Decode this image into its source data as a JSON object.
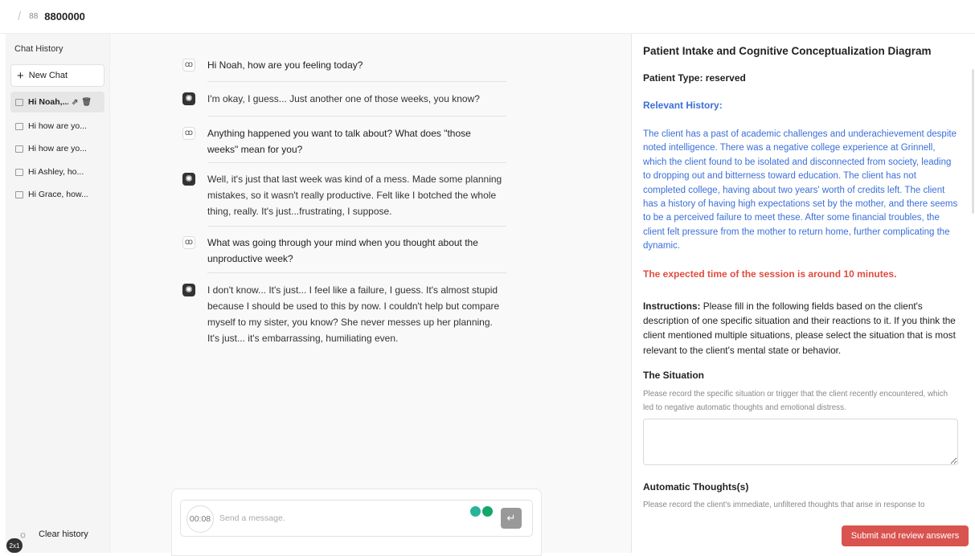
{
  "topbar": {
    "badge": "88",
    "title": "8800000"
  },
  "sidebar": {
    "heading": "Chat History",
    "new_chat": "New Chat",
    "items": [
      {
        "label": "Hi Noah,..."
      },
      {
        "label": "Hi how are yo..."
      },
      {
        "label": "Hi how are yo..."
      },
      {
        "label": "Hi Ashley, ho..."
      },
      {
        "label": "Hi Grace, how..."
      }
    ],
    "clear_history": "Clear history",
    "mini_badge": "2x1"
  },
  "messages": [
    {
      "role": "user",
      "text": "Hi Noah, how are you feeling today?"
    },
    {
      "role": "assistant",
      "text": "I'm okay, I guess... Just another one of those weeks, you know?"
    },
    {
      "role": "user",
      "text": "Anything happened you want to talk about? What does \"those weeks\" mean for you?"
    },
    {
      "role": "assistant",
      "text": "Well, it's just that last week was kind of a mess. Made some planning mistakes, so it wasn't really productive. Felt like I botched the whole thing, really. It's just...frustrating, I suppose."
    },
    {
      "role": "user",
      "text": "What was going through your mind when you thought about the unproductive week?"
    },
    {
      "role": "assistant",
      "text": "I don't know... It's just... I feel like a failure, I guess. It's almost stupid because I should be used to this by now. I couldn't help but compare myself to my sister, you know? She never messes up her planning. It's just... it's embarrassing, humiliating even."
    }
  ],
  "composer": {
    "timer": "00:08",
    "placeholder": "Send a message."
  },
  "panel": {
    "title": "Patient Intake and Cognitive Conceptualization Diagram",
    "patient_type": "Patient Type: reserved",
    "history_heading": "Relevant History:",
    "history_text": "The client has a past of academic challenges and underachievement despite noted intelligence. There was a negative college experience at Grinnell, which the client found to be isolated and disconnected from society, leading to dropping out and bitterness toward education. The client has not completed college, having about two years' worth of credits left. The client has a history of having high expectations set by the mother, and there seems to be a perceived failure to meet these. After some financial troubles, the client felt pressure from the mother to return home, further complicating the dynamic.",
    "expected_time": "The expected time of the session is around 10 minutes.",
    "instructions_label": "Instructions:",
    "instructions_text": " Please fill in the following fields based on the client's description of one specific situation and their reactions to it. If you think the client mentioned multiple situations, please select the situation that is most relevant to the client's mental state or behavior.",
    "situation_heading": "The Situation",
    "situation_desc": "Please record the specific situation or trigger that the client recently encountered, which led to negative automatic thoughts and emotional distress.",
    "thoughts_heading": "Automatic Thoughts(s)",
    "thoughts_desc": "Please record the client's immediate, unfiltered thoughts that arise in response to",
    "submit": "Submit and review answers"
  },
  "colors": {
    "history_blue": "#3b6fd8",
    "alert_red": "#e04b41",
    "submit_red": "#d9534f"
  }
}
